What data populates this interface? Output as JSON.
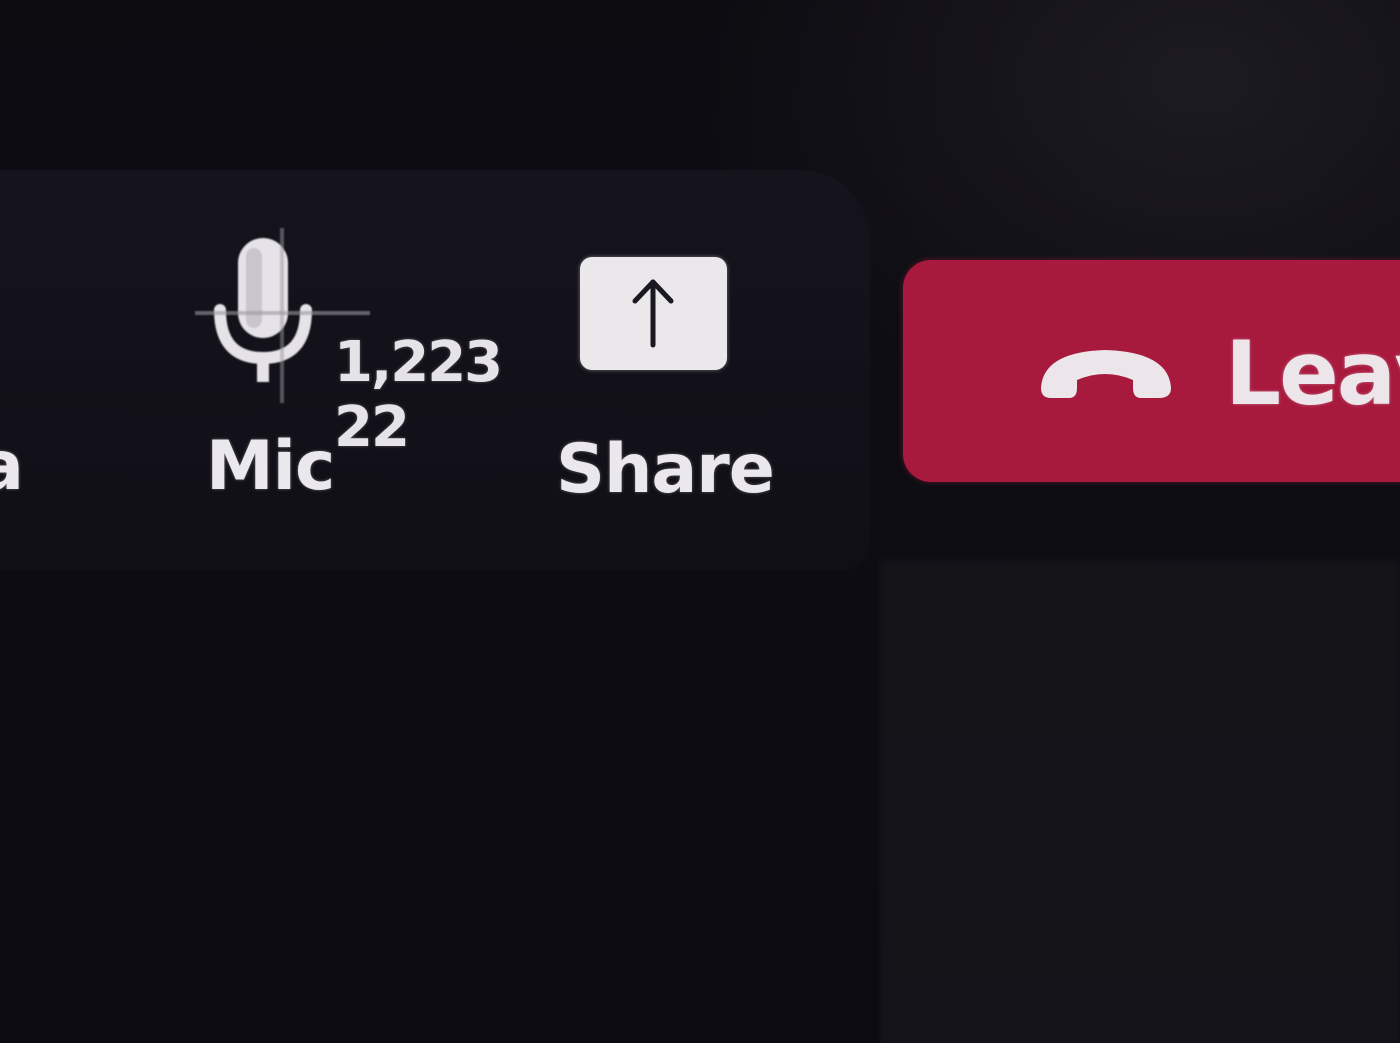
{
  "toolbar": {
    "camera": {
      "label_partial": "a"
    },
    "mic": {
      "label": "Mic",
      "icon": "microphone-icon",
      "count": "1,223",
      "sub_count": "22"
    },
    "share": {
      "label": "Share",
      "icon": "share-upload-icon"
    },
    "leave": {
      "label": "Leav",
      "icon": "hang-up-phone-icon",
      "color": "#a8193e"
    }
  }
}
